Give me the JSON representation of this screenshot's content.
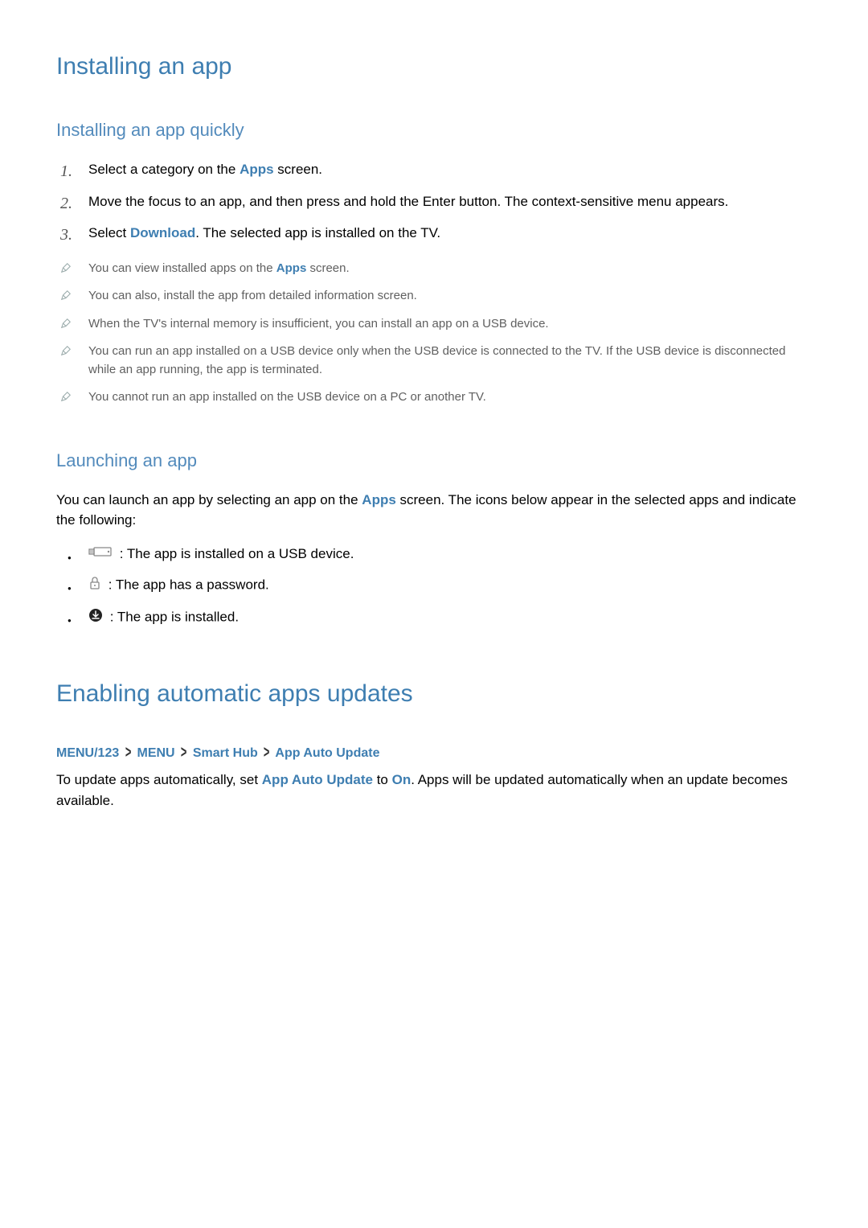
{
  "section1": {
    "title": "Installing an app",
    "subtitle": "Installing an app quickly",
    "step1_prefix": "Select a category on the ",
    "step1_link": "Apps",
    "step1_suffix": " screen.",
    "step2": "Move the focus to an app, and then press and hold the Enter button. The context-sensitive menu appears.",
    "step3_prefix": "Select ",
    "step3_link": "Download",
    "step3_suffix": ". The selected app is installed on the TV.",
    "note1_prefix": "You can view installed apps on the ",
    "note1_link": "Apps",
    "note1_suffix": " screen.",
    "note2": "You can also, install the app from detailed information screen.",
    "note3": "When the TV's internal memory is insufficient, you can install an app on a USB device.",
    "note4": "You can run an app installed on a USB device only when the USB device is connected to the TV. If the USB device is disconnected while an app running, the app is terminated.",
    "note5": "You cannot run an app installed on the USB device on a PC or another TV."
  },
  "section2": {
    "subtitle": "Launching an app",
    "intro_prefix": "You can launch an app by selecting an app on the ",
    "intro_link": "Apps",
    "intro_suffix": " screen. The icons below appear in the selected apps and indicate the following:",
    "icon1_text": " : The app is installed on a USB device.",
    "icon2_text": " : The app has a password.",
    "icon3_text": " : The app is installed."
  },
  "section3": {
    "title": "Enabling automatic apps updates",
    "bc1": "MENU/123",
    "bc2": "MENU",
    "bc3": "Smart Hub",
    "bc4": "App Auto Update",
    "text_prefix": "To update apps automatically, set ",
    "text_hl1": "App Auto Update",
    "text_mid": " to ",
    "text_hl2": "On",
    "text_suffix": ". Apps will be updated automatically when an update becomes available."
  }
}
